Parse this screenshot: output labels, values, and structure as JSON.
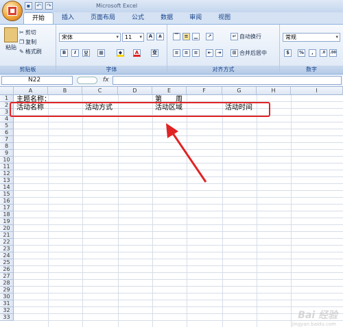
{
  "qat": {
    "save": "▪",
    "undo": "↶",
    "redo": "↷"
  },
  "window": {
    "title": "Microsoft Excel"
  },
  "tabs": [
    "开始",
    "插入",
    "页面布局",
    "公式",
    "数据",
    "审阅",
    "视图"
  ],
  "clipboard": {
    "paste": "粘贴",
    "cut": "剪切",
    "copy": "复制",
    "format_painter": "格式刷",
    "label": "剪贴板"
  },
  "font": {
    "name": "宋体",
    "size": "11",
    "grow": "A",
    "shrink": "A",
    "bold": "B",
    "italic": "I",
    "underline": "U",
    "wen": "变",
    "label": "字体"
  },
  "alignment": {
    "wrap": "自动换行",
    "merge": "合并后居中",
    "label": "对齐方式"
  },
  "number": {
    "format": "常规",
    "percent": "%",
    "comma": ",",
    "label": "数字"
  },
  "formula_bar": {
    "name_box": "N22",
    "fx": "fx"
  },
  "columns": [
    "A",
    "B",
    "C",
    "D",
    "E",
    "F",
    "G",
    "H",
    "I"
  ],
  "rows": [
    "1",
    "2",
    "3",
    "4",
    "5",
    "6",
    "7",
    "8",
    "9",
    "10",
    "11",
    "12",
    "13",
    "14",
    "15",
    "16",
    "17",
    "18",
    "19",
    "20",
    "21",
    "22",
    "23",
    "24",
    "25",
    "26",
    "27",
    "28",
    "29",
    "30",
    "31",
    "32",
    "33"
  ],
  "cells": {
    "a1": "主题名称：",
    "e1": "第____周",
    "a2": "活动名称",
    "c2": "活动方式",
    "e2": "活动区域",
    "g2": "活动时间"
  },
  "watermark": {
    "text": "Bai 经验",
    "sub": "jingyan.baidu.com"
  },
  "colors": {
    "accent": "#e02323",
    "ribbon": "#dce7f5"
  }
}
